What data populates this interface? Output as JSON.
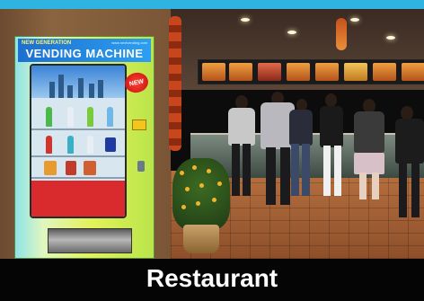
{
  "vending_machine": {
    "tagline": "NEW GENERATION",
    "url": "www.nextvending.com",
    "title": "VENDING MACHINE",
    "badge": "NEW"
  },
  "caption": "Restaurant",
  "colors": {
    "frame_top": "#2fb3e0",
    "caption_bg": "#050505",
    "caption_text": "#ffffff"
  }
}
